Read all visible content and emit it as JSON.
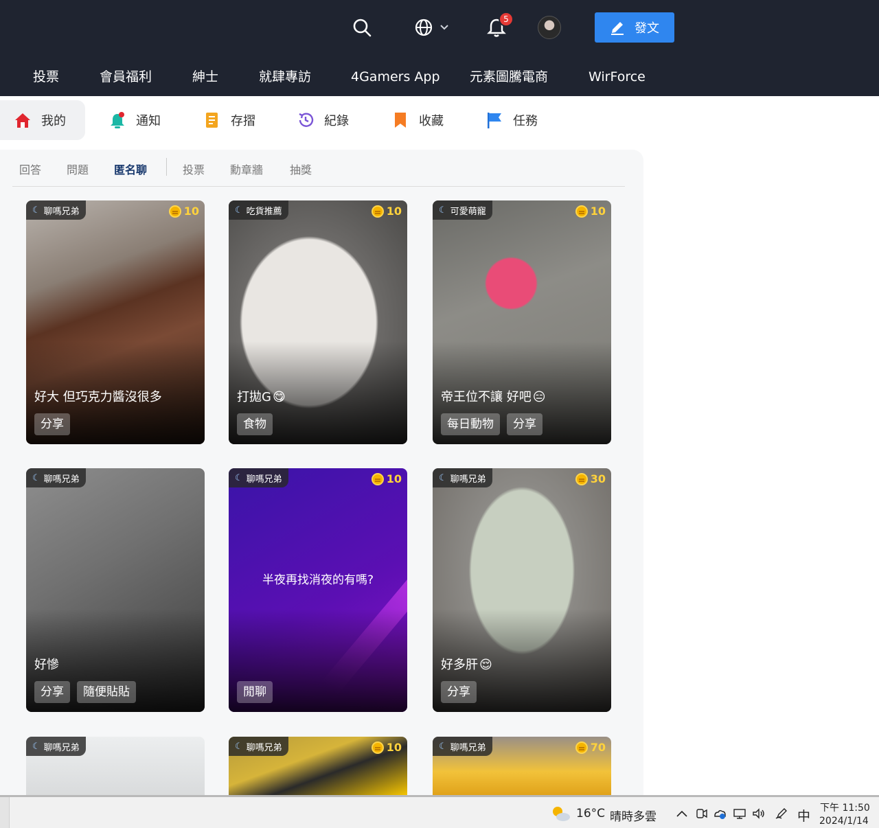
{
  "header": {
    "notification_count": "5",
    "post_button": "發文",
    "nav": [
      "投票",
      "會員福利",
      "紳士",
      "就肆專訪",
      "4Gamers App",
      "元素圖騰電商",
      "WirForce"
    ]
  },
  "subnav": [
    {
      "label": "我的",
      "icon": "home-icon"
    },
    {
      "label": "通知",
      "icon": "bell-icon"
    },
    {
      "label": "存摺",
      "icon": "passbook-icon"
    },
    {
      "label": "紀錄",
      "icon": "history-icon"
    },
    {
      "label": "收藏",
      "icon": "bookmark-icon"
    },
    {
      "label": "任務",
      "icon": "flag-icon"
    }
  ],
  "filter_tabs": [
    "回答",
    "問題",
    "匿名聊",
    "投票",
    "勳章牆",
    "抽獎"
  ],
  "active_filter": "匿名聊",
  "cards": [
    {
      "category": "聊嗎兄弟",
      "coins": "10",
      "title": "好大 但巧克力醬沒很多",
      "tags": [
        "分享"
      ]
    },
    {
      "category": "吃貨推薦",
      "coins": "10",
      "title": "打拋G",
      "emoji": "😋",
      "tags": [
        "食物"
      ]
    },
    {
      "category": "可愛萌寵",
      "coins": "10",
      "title": "帝王位不讓 好吧",
      "emoji": "😑",
      "tags": [
        "每日動物",
        "分享"
      ]
    },
    {
      "category": "聊嗎兄弟",
      "coins": "",
      "title": "好慘",
      "tags": [
        "分享",
        "隨便貼貼"
      ]
    },
    {
      "category": "聊嗎兄弟",
      "coins": "10",
      "title": "",
      "center_text": "半夜再找消夜的有嗎?",
      "tags": [
        "閒聊"
      ]
    },
    {
      "category": "聊嗎兄弟",
      "coins": "30",
      "title": "好多肝",
      "emoji": "😌",
      "tags": [
        "分享"
      ]
    },
    {
      "category": "聊嗎兄弟",
      "coins": "",
      "title": "",
      "tags": []
    },
    {
      "category": "聊嗎兄弟",
      "coins": "10",
      "title": "",
      "tags": []
    },
    {
      "category": "聊嗎兄弟",
      "coins": "70",
      "title": "",
      "tags": []
    }
  ],
  "taskbar": {
    "temperature": "16°C",
    "weather": "晴時多雲",
    "ime": "中",
    "time": "下午 11:50",
    "date": "2024/1/14"
  }
}
